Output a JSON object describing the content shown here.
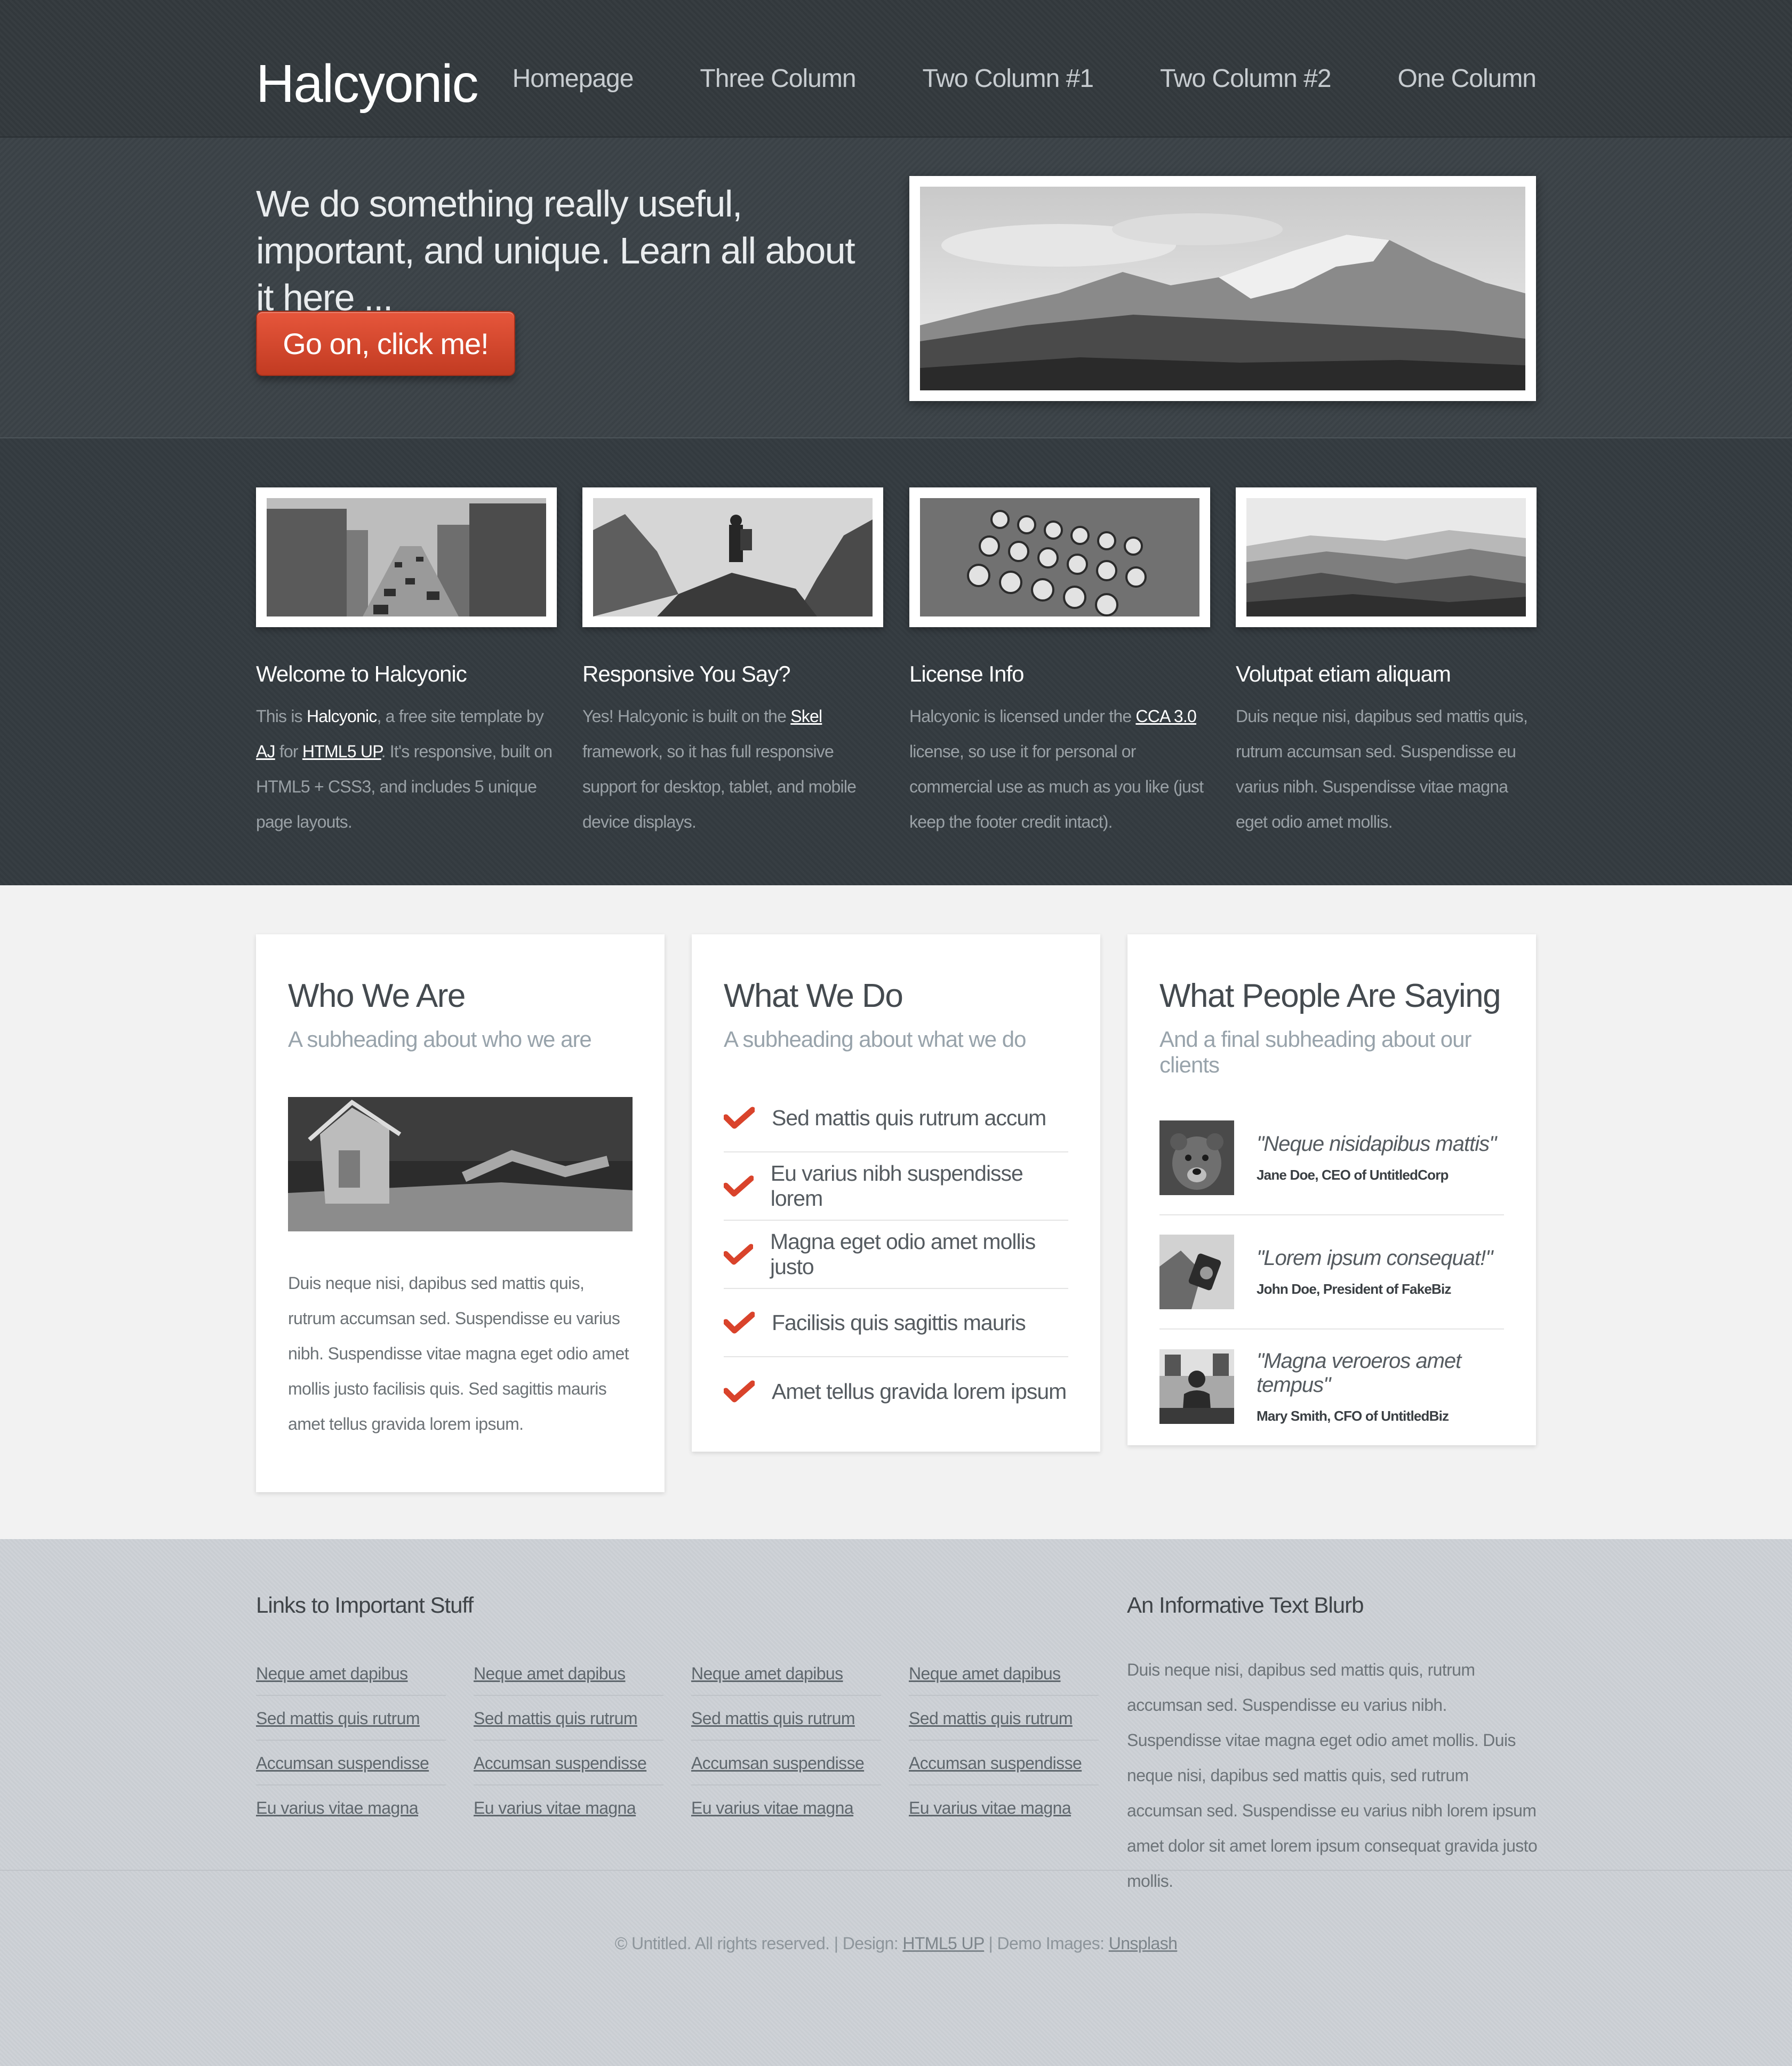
{
  "site": {
    "logo": "Halcyonic"
  },
  "nav": [
    {
      "label": "Homepage"
    },
    {
      "label": "Three Column"
    },
    {
      "label": "Two Column #1"
    },
    {
      "label": "Two Column #2"
    },
    {
      "label": "One Column"
    }
  ],
  "banner": {
    "text": "We do something really useful, important, and unique. Learn all about it here ...",
    "button": "Go on, click me!",
    "image_icon": "mountain-range-photo"
  },
  "features": [
    {
      "title": "Welcome to Halcyonic",
      "parts": [
        "This is ",
        "Halcyonic",
        ", a free site template by ",
        "AJ",
        " for ",
        "HTML5 UP",
        ". It's responsive, built on HTML5 + CSS3, and includes 5 unique page layouts."
      ],
      "image_icon": "city-traffic-photo"
    },
    {
      "title": "Responsive You Say?",
      "parts": [
        "Yes! Halcyonic is built on the ",
        "Skel",
        " framework, so it has full responsive support for desktop, tablet, and mobile device displays."
      ],
      "image_icon": "hiker-photo"
    },
    {
      "title": "License Info",
      "parts": [
        "Halcyonic is licensed under the ",
        "CCA 3.0",
        " license, so use it for personal or commercial use as much as you like (just keep the footer credit intact)."
      ],
      "image_icon": "typewriter-photo"
    },
    {
      "title": "Volutpat etiam aliquam",
      "text": "Duis neque nisi, dapibus sed mattis quis, rutrum accumsan sed. Suspendisse eu varius nibh. Suspendisse vitae magna eget odio amet mollis.",
      "image_icon": "hills-photo"
    }
  ],
  "who": {
    "title": "Who We Are",
    "subtitle": "A subheading about who we are",
    "text": "Duis neque nisi, dapibus sed mattis quis, rutrum accumsan sed. Suspendisse eu varius nibh. Suspendisse vitae magna eget odio amet mollis justo facilisis quis. Sed sagittis mauris amet tellus gravida lorem ipsum.",
    "image_icon": "cabin-photo"
  },
  "what": {
    "title": "What We Do",
    "subtitle": "A subheading about what we do",
    "items": [
      "Sed mattis quis rutrum accum",
      "Eu varius nibh suspendisse lorem",
      "Magna eget odio amet mollis justo",
      "Facilisis quis sagittis mauris",
      "Amet tellus gravida lorem ipsum"
    ]
  },
  "people": {
    "title": "What People Are Saying",
    "subtitle": "And a final subheading about our clients",
    "quotes": [
      {
        "text": "\"Neque nisidapibus mattis\"",
        "by": "Jane Doe, CEO of UntitledCorp",
        "image_icon": "bear-photo"
      },
      {
        "text": "\"Lorem ipsum consequat!\"",
        "by": "John Doe, President of FakeBiz",
        "image_icon": "camera-hands-photo"
      },
      {
        "text": "\"Magna veroeros amet tempus\"",
        "by": "Mary Smith, CFO of UntitledBiz",
        "image_icon": "seated-person-photo"
      }
    ]
  },
  "footer": {
    "links_title": "Links to Important Stuff",
    "link_columns": [
      [
        "Neque amet dapibus",
        "Sed mattis quis rutrum",
        "Accumsan suspendisse",
        "Eu varius vitae magna"
      ],
      [
        "Neque amet dapibus",
        "Sed mattis quis rutrum",
        "Accumsan suspendisse",
        "Eu varius vitae magna"
      ],
      [
        "Neque amet dapibus",
        "Sed mattis quis rutrum",
        "Accumsan suspendisse",
        "Eu varius vitae magna"
      ],
      [
        "Neque amet dapibus",
        "Sed mattis quis rutrum",
        "Accumsan suspendisse",
        "Eu varius vitae magna"
      ]
    ],
    "blurb_title": "An Informative Text Blurb",
    "blurb": "Duis neque nisi, dapibus sed mattis quis, rutrum accumsan sed. Suspendisse eu varius nibh. Suspendisse vitae magna eget odio amet mollis. Duis neque nisi, dapibus sed mattis quis, sed rutrum accumsan sed. Suspendisse eu varius nibh lorem ipsum amet dolor sit amet lorem ipsum consequat gravida justo mollis.",
    "copyright_parts": [
      "© Untitled. All rights reserved. | Design: ",
      "HTML5 UP",
      " | Demo Images: ",
      "Unsplash"
    ]
  },
  "colors": {
    "accent": "#d9432b",
    "header_bg": "#33393d",
    "banner_bg": "#3b4247",
    "main_bg": "#f2f2f2",
    "footer_bg": "#ccd0d5"
  }
}
